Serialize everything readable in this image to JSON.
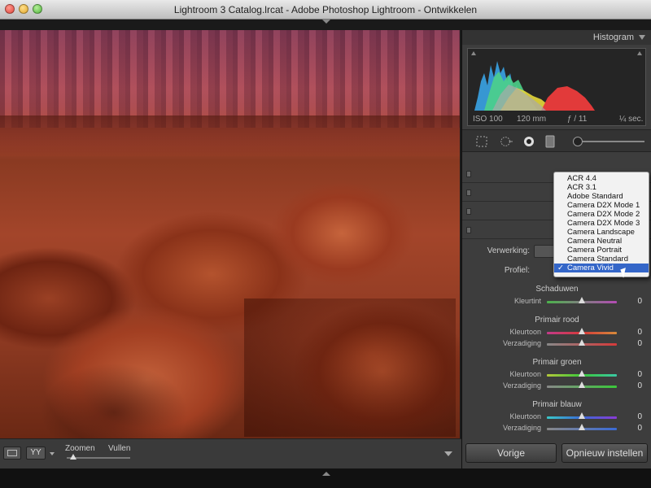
{
  "window": {
    "title": "Lightroom 3 Catalog.lrcat - Adobe Photoshop Lightroom - Ontwikkelen"
  },
  "histogram": {
    "title": "Histogram",
    "iso": "ISO 100",
    "focal": "120 mm",
    "aperture": "ƒ / 11",
    "shutter": "¼ sec."
  },
  "panel": {
    "verwerking_label": "Verwerking:",
    "profiel_label": "Profiel:",
    "shadows": {
      "title": "Schaduwen",
      "rows": [
        {
          "label": "Kleurtint",
          "value": "0"
        }
      ]
    },
    "red": {
      "title": "Primair rood",
      "rows": [
        {
          "label": "Kleurtoon",
          "value": "0"
        },
        {
          "label": "Verzadiging",
          "value": "0"
        }
      ]
    },
    "green": {
      "title": "Primair groen",
      "rows": [
        {
          "label": "Kleurtoon",
          "value": "0"
        },
        {
          "label": "Verzadiging",
          "value": "0"
        }
      ]
    },
    "blue": {
      "title": "Primair blauw",
      "rows": [
        {
          "label": "Kleurtoon",
          "value": "0"
        },
        {
          "label": "Verzadiging",
          "value": "0"
        }
      ]
    },
    "prev_button": "Vorige",
    "reset_button": "Opnieuw instellen"
  },
  "profile_dropdown": {
    "options": [
      "ACR 4.4",
      "ACR 3.1",
      "Adobe Standard",
      "Camera D2X Mode 1",
      "Camera D2X Mode 2",
      "Camera D2X Mode 3",
      "Camera Landscape",
      "Camera Neutral",
      "Camera Portrait",
      "Camera Standard",
      "Camera Vivid"
    ],
    "selected": "Camera Vivid",
    "check": "✓"
  },
  "toolbar": {
    "yy_label": "YY",
    "zoom_label": "Zoomen",
    "fill_label": "Vullen"
  },
  "colors": {
    "accent_selection": "#3466c8",
    "panel_bg": "#3d3d3d"
  }
}
